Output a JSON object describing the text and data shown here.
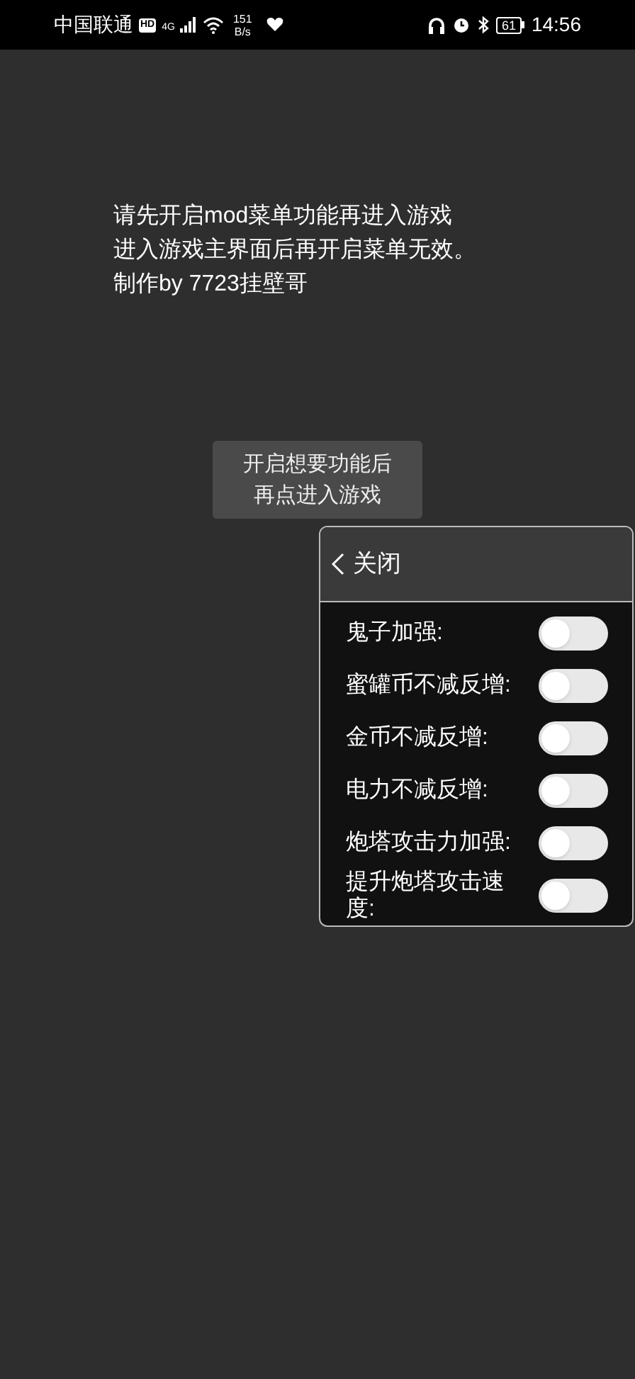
{
  "status_bar": {
    "carrier": "中国联通",
    "hd_badge": "HD",
    "network": "4G",
    "speed_value": "151",
    "speed_unit": "B/s",
    "battery": "61",
    "time": "14:56"
  },
  "notice": [
    "请先开启mod菜单功能再进入游戏",
    "进入游戏主界面后再开启菜单无效。",
    "制作by 7723挂壁哥"
  ],
  "start_button": [
    "开启想要功能后",
    "再点进入游戏"
  ],
  "menu": {
    "back_label": "关闭",
    "items": [
      {
        "label": "鬼子加强:",
        "on": false
      },
      {
        "label": "蜜罐币不减反增:",
        "on": false
      },
      {
        "label": "金币不减反增:",
        "on": false
      },
      {
        "label": "电力不减反增:",
        "on": false
      },
      {
        "label": "炮塔攻击力加强:",
        "on": false
      },
      {
        "label": "提升炮塔攻击速度:",
        "on": false
      }
    ]
  }
}
